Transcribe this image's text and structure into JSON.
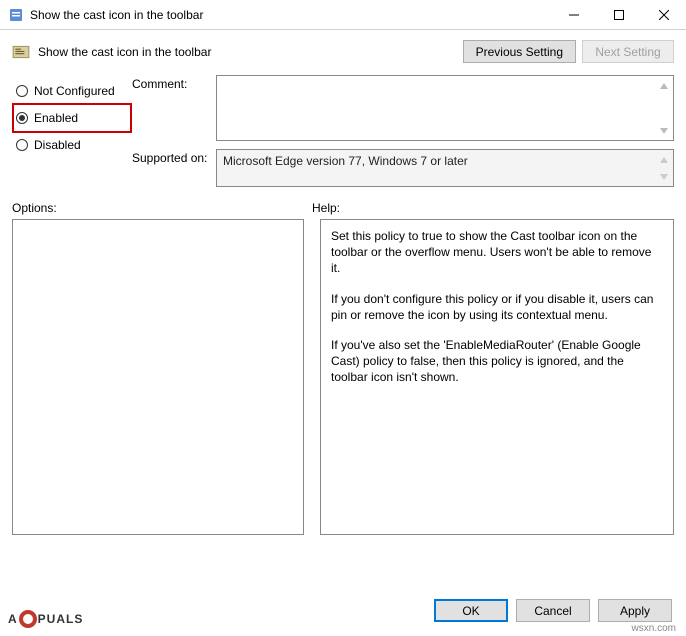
{
  "titlebar": {
    "title": "Show the cast icon in the toolbar"
  },
  "header": {
    "title": "Show the cast icon in the toolbar",
    "prev_setting": "Previous Setting",
    "next_setting": "Next Setting"
  },
  "radios": {
    "not_configured": "Not Configured",
    "enabled": "Enabled",
    "disabled": "Disabled"
  },
  "fields": {
    "comment_label": "Comment:",
    "comment_value": "",
    "supported_label": "Supported on:",
    "supported_value": "Microsoft Edge version 77, Windows 7 or later"
  },
  "lower": {
    "options_label": "Options:",
    "help_label": "Help:"
  },
  "help": {
    "p1": "Set this policy to true to show the Cast toolbar icon on the toolbar or the overflow menu. Users won't be able to remove it.",
    "p2": "If you don't configure this policy or if you disable it, users can pin or remove the icon by using its contextual menu.",
    "p3": "If you've also set the 'EnableMediaRouter' (Enable Google Cast) policy to false, then this policy is ignored, and the toolbar icon isn't shown."
  },
  "buttons": {
    "ok": "OK",
    "cancel": "Cancel",
    "apply": "Apply"
  },
  "watermark": {
    "prefix": "A",
    "suffix": "PUALS",
    "site": "wsxn.com"
  }
}
